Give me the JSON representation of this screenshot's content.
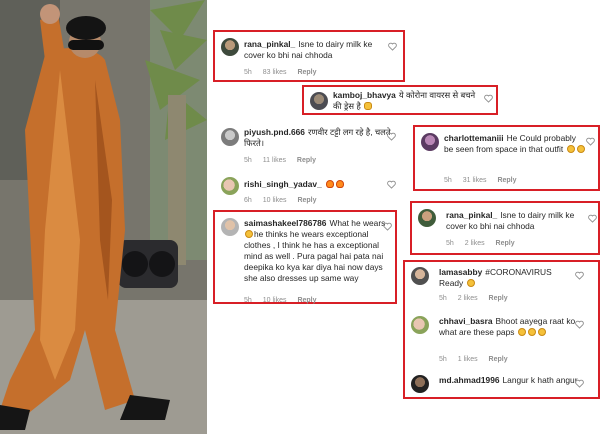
{
  "photo": {
    "subject_icon": "man-in-shiny-copper-suit-photo"
  },
  "comments": [
    {
      "user": "rana_pinkal_",
      "text": "Isne to dairy milk ke cover ko bhi nai chhoda",
      "time": "5h",
      "likes": "83 likes",
      "reply": "Reply"
    },
    {
      "user": "kamboj_bhavya",
      "text": "ये कोरोना वायरस से बचने की ड्रेस है",
      "emoji": "thumbs-up"
    },
    {
      "user": "piyush.pnd.666",
      "text": "रणवीर टट्टी लग रहे है, चलते फिरते।",
      "time": "5h",
      "likes": "11 likes",
      "reply": "Reply"
    },
    {
      "user": "rishi_singh_yadav_",
      "emoji": "fire",
      "time": "6h",
      "likes": "10 likes",
      "reply": "Reply"
    },
    {
      "user": "saimashakeel786786",
      "text_a": "What he wears",
      "text_b": "he thinks he wears exceptional clothes , I think he has a exceptional mind as well . Pura pagal hai pata nai deepika ko kya kar diya hai now days she also dresses up same way",
      "time": "5h",
      "likes": "10 likes",
      "reply": "Reply"
    },
    {
      "user": "charlottemaniii",
      "text": "He Could probably be seen from space in that outfit",
      "time": "5h",
      "likes": "31 likes",
      "reply": "Reply"
    },
    {
      "user": "rana_pinkal_",
      "text": "Isne to dairy milk ke cover ko bhi nai chhoda",
      "time": "5h",
      "likes": "2 likes",
      "reply": "Reply"
    },
    {
      "user": "lamasabby",
      "text": "#CORONAVIRUS",
      "text_b": "Ready",
      "time": "5h",
      "likes": "2 likes",
      "reply": "Reply"
    },
    {
      "user": "chhavi_basra",
      "text": "Bhoot aayega raat ko what are these paps",
      "time": "5h",
      "likes": "1 likes",
      "reply": "Reply"
    },
    {
      "user": "md.ahmad1996",
      "text": "Langur k hath angur"
    }
  ],
  "colors": {
    "highlight_border": "#d81f26",
    "meta_gray": "#8e8e8e",
    "text": "#262626"
  }
}
